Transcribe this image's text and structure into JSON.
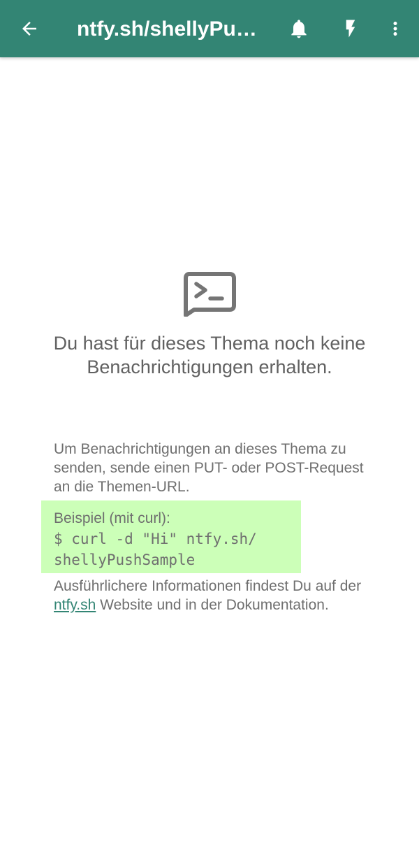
{
  "colors": {
    "toolbar": "#338574",
    "toolbar_text": "#ffffff",
    "body_text": "#6f6f6f",
    "link": "#338574",
    "example_highlight": "#ccffb8",
    "icon": "#757575"
  },
  "toolbar": {
    "back_icon": "arrow-back-icon",
    "title": "ntfy.sh/shellyPushSample",
    "notifications_icon": "bell-icon",
    "instant_icon": "lightning-bolt-icon",
    "more_icon": "more-vert-icon"
  },
  "empty_state": {
    "icon": "terminal-message-icon",
    "title": "Du hast für dieses Thema noch keine Benachrichtigungen erhalten.",
    "instructions": "Um Benachrichtigungen an dieses Thema zu senden, sende einen PUT- oder POST-Request an die Themen-URL.",
    "example_label": "Beispiel (mit curl):",
    "example_command": "$ curl -d \"Hi\" ntfy.sh/\nshellyPushSample",
    "more_info_before": "Ausführlichere Informationen findest Du auf der ",
    "more_info_link": "ntfy.sh",
    "more_info_after": " Website und in der Dokumentation."
  }
}
